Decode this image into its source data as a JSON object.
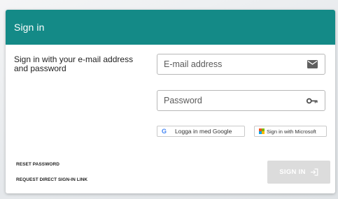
{
  "header": {
    "title": "Sign in",
    "color": "#148a87"
  },
  "intro": {
    "text": "Sign in with your e-mail address and password"
  },
  "email": {
    "placeholder": "E-mail address",
    "icon": "envelope-icon"
  },
  "password": {
    "placeholder": "Password",
    "icon": "key-icon"
  },
  "social": {
    "google_label": "Logga in med Google",
    "google_icon": "google-logo-icon",
    "microsoft_label": "Sign in with Microsoft",
    "microsoft_icon": "microsoft-logo-icon"
  },
  "links": {
    "reset_password": "RESET PASSWORD",
    "request_link": "REQUEST DIRECT SIGN-IN LINK"
  },
  "signin_button": {
    "label": "SIGN IN",
    "icon": "sign-in-arrow-icon",
    "state": "disabled"
  }
}
